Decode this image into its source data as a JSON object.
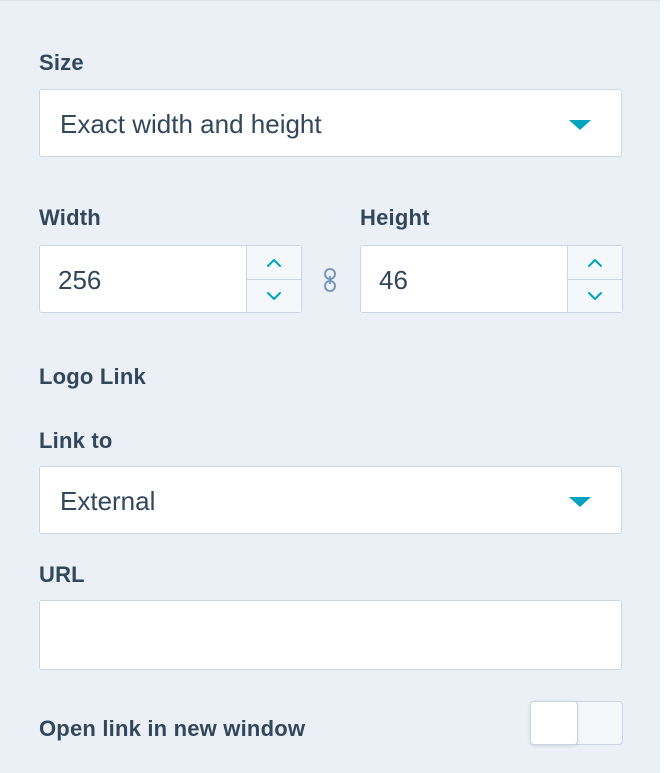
{
  "size": {
    "label": "Size",
    "selected": "Exact width and height"
  },
  "dimensions": {
    "width_label": "Width",
    "width_value": "256",
    "height_label": "Height",
    "height_value": "46"
  },
  "logo_link": {
    "section_title": "Logo Link",
    "link_to_label": "Link to",
    "link_to_selected": "External",
    "url_label": "URL",
    "url_value": "",
    "open_new_window_label": "Open link in new window",
    "open_new_window_enabled": false
  },
  "colors": {
    "panel_bg": "#eaf0f6",
    "text": "#33475b",
    "accent": "#00a4bd",
    "border": "#cbd6e2"
  },
  "icons": {
    "select_caret": "caret-down-icon",
    "stepper_up": "chevron-up-icon",
    "stepper_down": "chevron-down-icon",
    "aspect_lock": "link-chain-icon"
  }
}
